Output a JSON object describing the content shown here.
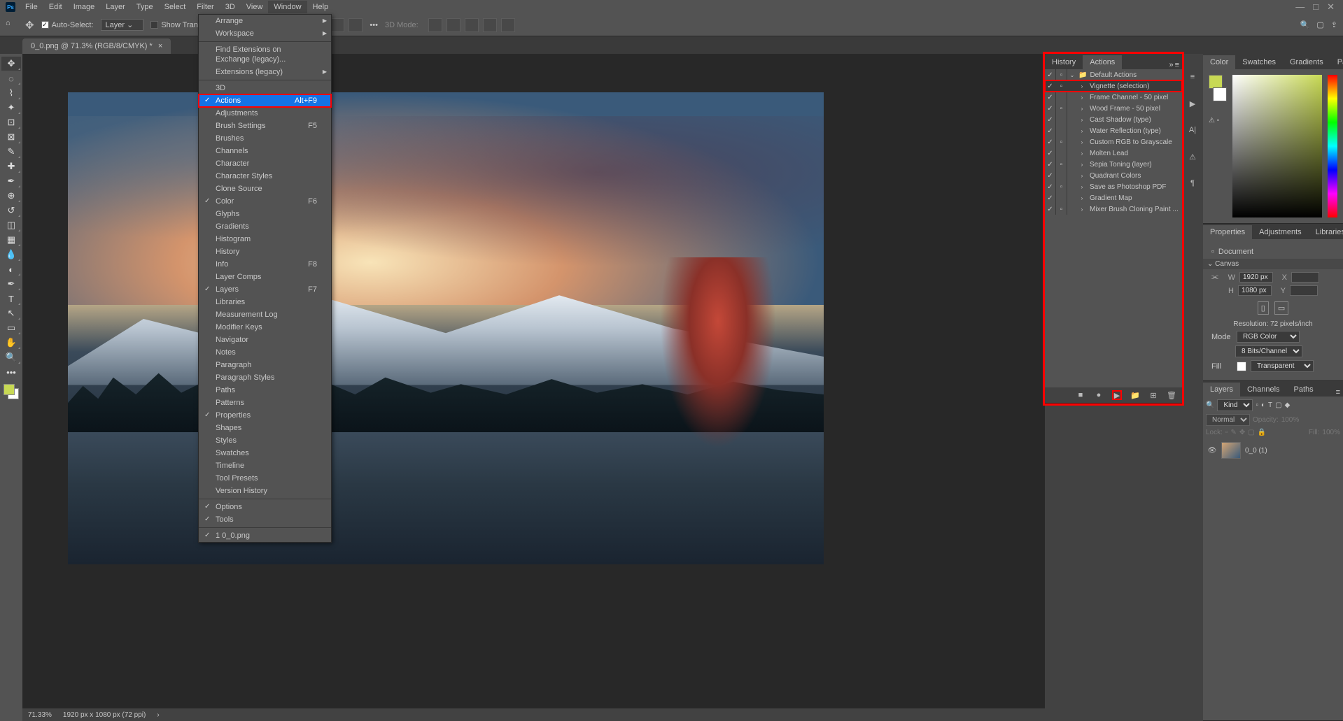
{
  "menubar": [
    "File",
    "Edit",
    "Image",
    "Layer",
    "Type",
    "Select",
    "Filter",
    "3D",
    "View",
    "Window",
    "Help"
  ],
  "active_menu_index": 9,
  "options": {
    "auto_select": "Auto-Select:",
    "layer": "Layer",
    "show_transform": "Show Transform Controls",
    "mode3d": "3D Mode:"
  },
  "doc_tab": "0_0.png @ 71.3% (RGB/8/CMYK) *",
  "dropdown": {
    "groups": [
      [
        {
          "label": "Arrange",
          "arrow": true
        },
        {
          "label": "Workspace",
          "arrow": true
        }
      ],
      [
        {
          "label": "Find Extensions on Exchange (legacy)..."
        },
        {
          "label": "Extensions (legacy)",
          "arrow": true
        }
      ],
      [
        {
          "label": "3D"
        },
        {
          "label": "Actions",
          "shortcut": "Alt+F9",
          "highlight": true,
          "red": true,
          "check": true
        },
        {
          "label": "Adjustments"
        },
        {
          "label": "Brush Settings",
          "shortcut": "F5"
        },
        {
          "label": "Brushes"
        },
        {
          "label": "Channels"
        },
        {
          "label": "Character"
        },
        {
          "label": "Character Styles"
        },
        {
          "label": "Clone Source"
        },
        {
          "label": "Color",
          "shortcut": "F6",
          "check": true
        },
        {
          "label": "Glyphs"
        },
        {
          "label": "Gradients"
        },
        {
          "label": "Histogram"
        },
        {
          "label": "History"
        },
        {
          "label": "Info",
          "shortcut": "F8"
        },
        {
          "label": "Layer Comps"
        },
        {
          "label": "Layers",
          "shortcut": "F7",
          "check": true
        },
        {
          "label": "Libraries"
        },
        {
          "label": "Measurement Log"
        },
        {
          "label": "Modifier Keys"
        },
        {
          "label": "Navigator"
        },
        {
          "label": "Notes"
        },
        {
          "label": "Paragraph"
        },
        {
          "label": "Paragraph Styles"
        },
        {
          "label": "Paths"
        },
        {
          "label": "Patterns"
        },
        {
          "label": "Properties",
          "check": true
        },
        {
          "label": "Shapes"
        },
        {
          "label": "Styles"
        },
        {
          "label": "Swatches"
        },
        {
          "label": "Timeline"
        },
        {
          "label": "Tool Presets"
        },
        {
          "label": "Version History"
        }
      ],
      [
        {
          "label": "Options",
          "check": true
        },
        {
          "label": "Tools",
          "check": true
        }
      ],
      [
        {
          "label": "1 0_0.png",
          "check": true
        }
      ]
    ]
  },
  "actions": {
    "tabs": [
      "History",
      "Actions"
    ],
    "default_set": "Default Actions",
    "items": [
      {
        "name": "Vignette (selection)",
        "dlg": true,
        "selected": true,
        "red": true
      },
      {
        "name": "Frame Channel - 50 pixel"
      },
      {
        "name": "Wood Frame - 50 pixel",
        "dlg": true
      },
      {
        "name": "Cast Shadow (type)"
      },
      {
        "name": "Water Reflection (type)"
      },
      {
        "name": "Custom RGB to Grayscale",
        "dlg": true
      },
      {
        "name": "Molten Lead"
      },
      {
        "name": "Sepia Toning (layer)",
        "dlg": true
      },
      {
        "name": "Quadrant Colors"
      },
      {
        "name": "Save as Photoshop PDF",
        "dlg": true
      },
      {
        "name": "Gradient Map"
      },
      {
        "name": "Mixer Brush Cloning Paint ...",
        "dlg": true
      }
    ]
  },
  "color": {
    "tabs": [
      "Color",
      "Swatches",
      "Gradients",
      "Patterns"
    ]
  },
  "properties": {
    "tabs": [
      "Properties",
      "Adjustments",
      "Libraries"
    ],
    "doc": "Document",
    "canvas": "Canvas",
    "w": "W",
    "wval": "1920 px",
    "xlab": "X",
    "h": "H",
    "hval": "1080 px",
    "ylab": "Y",
    "res": "Resolution: 72 pixels/inch",
    "mode": "Mode",
    "modeval": "RGB Color",
    "bits": "8 Bits/Channel",
    "fill": "Fill",
    "fillval": "Transparent"
  },
  "layers": {
    "tabs": [
      "Layers",
      "Channels",
      "Paths"
    ],
    "kind": "Kind",
    "normal": "Normal",
    "opacity": "Opacity:",
    "opval": "100%",
    "lock": "Lock:",
    "fill": "Fill:",
    "fillval": "100%",
    "layer_name": "0_0 (1)"
  },
  "status": {
    "zoom": "71.33%",
    "dims": "1920 px x 1080 px (72 ppi)"
  }
}
